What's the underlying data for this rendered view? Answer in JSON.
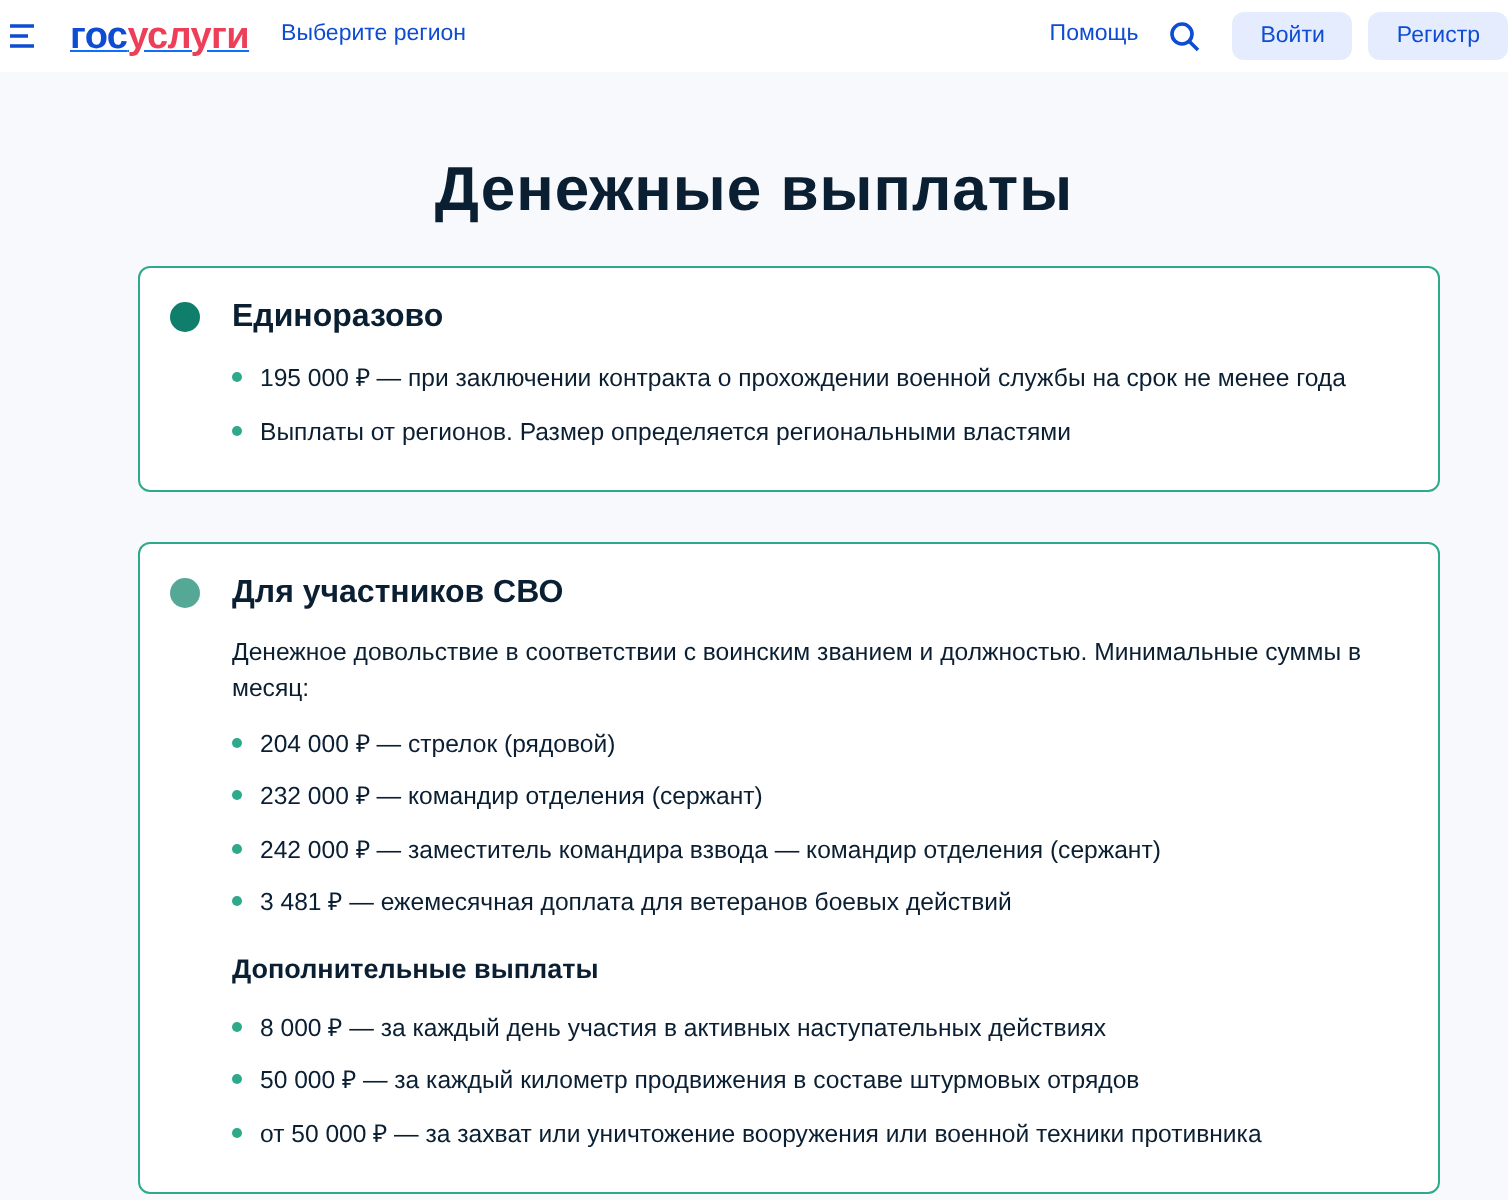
{
  "header": {
    "logo": {
      "prefix": "гос",
      "suffix": "услуги"
    },
    "region_link": "Выберите регион",
    "help_link": "Помощь",
    "buttons": [
      "Войти",
      "Регистр"
    ]
  },
  "page_title": "Денежные выплаты",
  "cards": [
    {
      "title": "Единоразово",
      "color": "#0f7f6b",
      "blocks": [
        {
          "kind": "list",
          "items": [
            "195 000 ₽ — при заключении контракта о прохождении военной службы на срок не менее года",
            "Выплаты от регионов. Размер определяется региональными властями"
          ]
        }
      ]
    },
    {
      "title": "Для участников СВО",
      "color": "#55a896",
      "blocks": [
        {
          "kind": "paragraph",
          "text": "Денежное довольствие в соответствии с воинским званием и должностью. Минимальные суммы в месяц:"
        },
        {
          "kind": "list",
          "items": [
            "204 000 ₽ — стрелок (рядовой)",
            "232 000 ₽ — командир отделения (сержант)",
            "242 000 ₽ — заместитель командира взвода — командир отделения (сержант)",
            "3 481 ₽ — ежемесячная доплата для ветеранов боевых действий"
          ]
        },
        {
          "kind": "subheading",
          "text": "Дополнительные выплаты"
        },
        {
          "kind": "list",
          "items": [
            "8 000 ₽ — за каждый день участия в активных наступательных действиях",
            "50 000 ₽ — за каждый километр продвижения в составе штурмовых отрядов",
            "от 50 000 ₽ — за захват или уничтожение вооружения или военной техники противника"
          ]
        }
      ]
    }
  ]
}
